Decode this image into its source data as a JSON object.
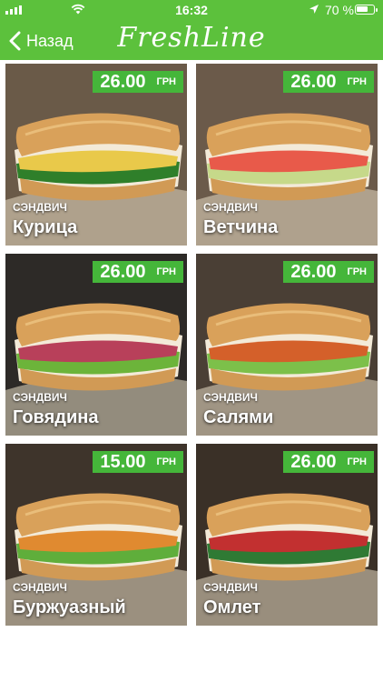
{
  "status_bar": {
    "time": "16:32",
    "battery": "70 %",
    "battery_level": 0.7
  },
  "header": {
    "back_label": "Назад",
    "logo": "FreshLine"
  },
  "colors": {
    "brand_green": "#5cc13c",
    "price_green": "#45b63a"
  },
  "products": [
    {
      "category": "СЭНДВИЧ",
      "name": "Курица",
      "price": "26.00",
      "currency": "ГРН",
      "bg": "#6a5a48",
      "sauce": "#e9c94a",
      "veg": "#2f7f2a"
    },
    {
      "category": "СЭНДВИЧ",
      "name": "Ветчина",
      "price": "26.00",
      "currency": "ГРН",
      "bg": "#6b5a4a",
      "sauce": "#e85a4a",
      "veg": "#c6d98a"
    },
    {
      "category": "СЭНДВИЧ",
      "name": "Говядина",
      "price": "26.00",
      "currency": "ГРН",
      "bg": "#2d2a27",
      "sauce": "#b8405a",
      "veg": "#6cb43a"
    },
    {
      "category": "СЭНДВИЧ",
      "name": "Салями",
      "price": "26.00",
      "currency": "ГРН",
      "bg": "#4a3f35",
      "sauce": "#d4602a",
      "veg": "#7cc04a"
    },
    {
      "category": "СЭНДВИЧ",
      "name": "Буржуазный",
      "price": "15.00",
      "currency": "ГРН",
      "bg": "#3e342b",
      "sauce": "#e08a30",
      "veg": "#5fae3b"
    },
    {
      "category": "СЭНДВИЧ",
      "name": "Омлет",
      "price": "26.00",
      "currency": "ГРН",
      "bg": "#3a3027",
      "sauce": "#c23030",
      "veg": "#2f7a34"
    }
  ]
}
